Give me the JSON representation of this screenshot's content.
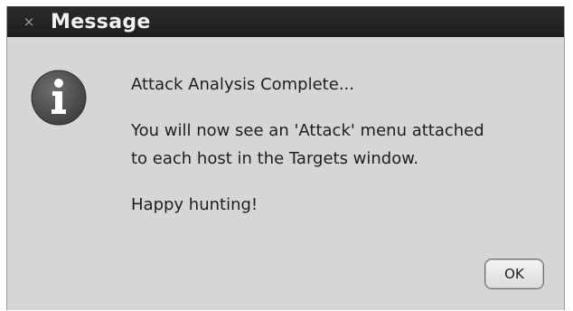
{
  "dialog": {
    "title": "Message",
    "close_glyph": "×",
    "icon": "info-icon",
    "message": {
      "heading": "Attack Analysis Complete...",
      "line1": "You will now see an 'Attack' menu attached",
      "line2": "to each host in the Targets window.",
      "closing": "Happy hunting!"
    },
    "ok_label": "OK"
  },
  "colors": {
    "titlebar": "#222222",
    "window_bg": "#d6d6d6",
    "icon_bg": "#555555"
  }
}
